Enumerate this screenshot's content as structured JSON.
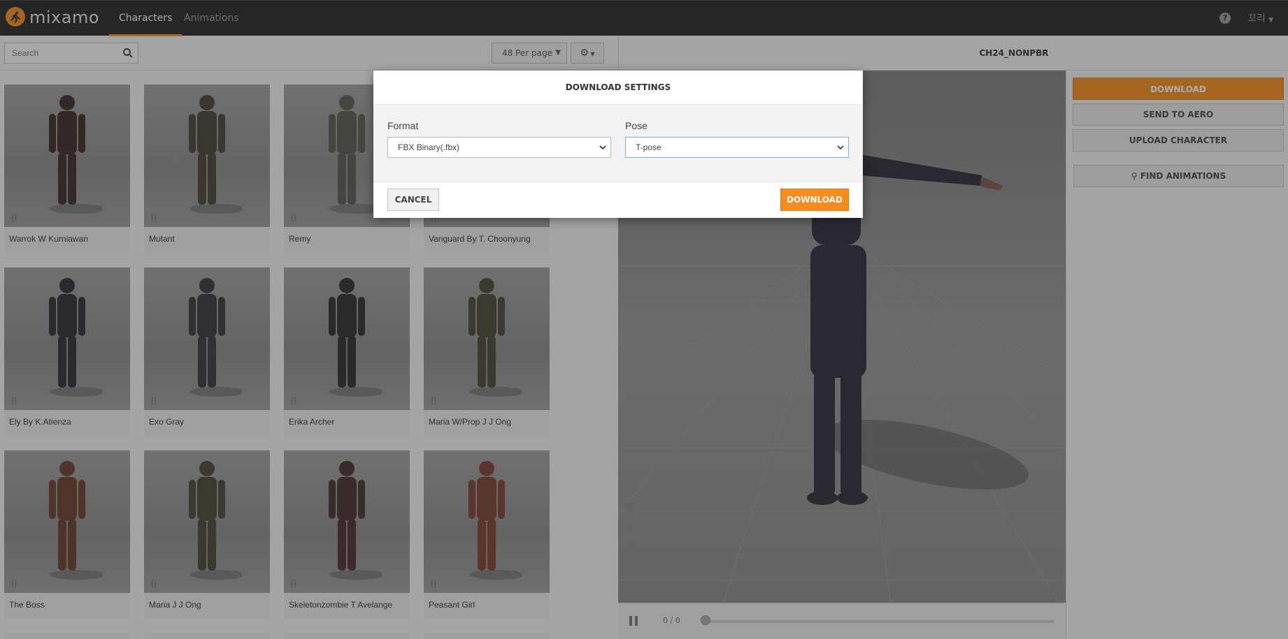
{
  "app": {
    "logo_text": "mixamo",
    "user": "꼬리"
  },
  "nav": {
    "tabs": [
      {
        "label": "Characters",
        "active": true
      },
      {
        "label": "Animations",
        "active": false
      }
    ]
  },
  "toolbar": {
    "search_placeholder": "Search",
    "per_page": "48 Per page"
  },
  "viewer": {
    "title": "CH24_NONPBR",
    "time": "0 / 0"
  },
  "side": {
    "download": "DOWNLOAD",
    "send_to_aero": "SEND TO AERO",
    "upload_character": "UPLOAD CHARACTER",
    "find_animations": "FIND ANIMATIONS"
  },
  "characters": [
    {
      "name": "Warrok W Kurniawan",
      "color": "#3b2a28"
    },
    {
      "name": "Mutant",
      "color": "#4a4038"
    },
    {
      "name": "Remy",
      "color": "#5a5a52"
    },
    {
      "name": "Vanguard By T. Choonyung",
      "color": "#4a4a50"
    },
    {
      "name": "Ely By K.Atienza",
      "color": "#2e2e34"
    },
    {
      "name": "Exo Gray",
      "color": "#34383c"
    },
    {
      "name": "Erika Archer",
      "color": "#2e2a2a"
    },
    {
      "name": "Maria W/Prop J J Ong",
      "color": "#4a4632"
    },
    {
      "name": "The Boss",
      "color": "#6a3a2e"
    },
    {
      "name": "Maria J J Ong",
      "color": "#4a4632"
    },
    {
      "name": "Skeletonzombie T Avelange",
      "color": "#4a2e2e"
    },
    {
      "name": "Peasant Girl",
      "color": "#7a4030"
    }
  ],
  "modal": {
    "title": "DOWNLOAD SETTINGS",
    "format_label": "Format",
    "format_value": "FBX Binary(.fbx)",
    "pose_label": "Pose",
    "pose_value": "T-pose",
    "cancel": "CANCEL",
    "download": "DOWNLOAD"
  },
  "colors": {
    "accent": "#f68b1f",
    "topbar": "#262626"
  }
}
